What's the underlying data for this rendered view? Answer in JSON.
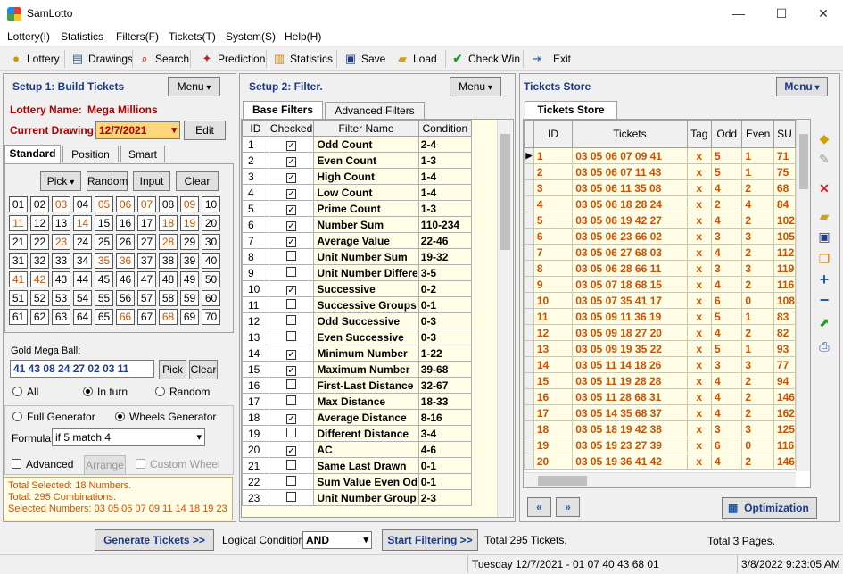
{
  "window": {
    "title": "SamLotto",
    "min": "—",
    "max": "☐",
    "close": "✕"
  },
  "menubar": [
    "Lottery(I)",
    "Statistics",
    "Filters(F)",
    "Tickets(T)",
    "System(S)",
    "Help(H)"
  ],
  "toolbar": {
    "lottery": "Lottery",
    "drawings": "Drawings",
    "search": "Search",
    "prediction": "Prediction",
    "statistics": "Statistics",
    "save": "Save",
    "load": "Load",
    "check_win": "Check Win",
    "exit": "Exit"
  },
  "setup1": {
    "title": "Setup 1: Build  Tickets",
    "menu_button": "Menu",
    "lottery_name_label": "Lottery  Name:",
    "lottery_name": "Mega Millions",
    "current_drawing_label": "Current Drawing:",
    "current_drawing": "12/7/2021",
    "edit": "Edit",
    "tabs": [
      "Standard",
      "Position",
      "Smart"
    ],
    "pick": "Pick",
    "random": "Random",
    "input": "Input",
    "clear": "Clear",
    "numbers": [
      "01",
      "02",
      "03",
      "04",
      "05",
      "06",
      "07",
      "08",
      "09",
      "10",
      "11",
      "12",
      "13",
      "14",
      "15",
      "16",
      "17",
      "18",
      "19",
      "20",
      "21",
      "22",
      "23",
      "24",
      "25",
      "26",
      "27",
      "28",
      "29",
      "30",
      "31",
      "32",
      "33",
      "34",
      "35",
      "36",
      "37",
      "38",
      "39",
      "40",
      "41",
      "42",
      "43",
      "44",
      "45",
      "46",
      "47",
      "48",
      "49",
      "50",
      "51",
      "52",
      "53",
      "54",
      "55",
      "56",
      "57",
      "58",
      "59",
      "60",
      "61",
      "62",
      "63",
      "64",
      "65",
      "66",
      "67",
      "68",
      "69",
      "70"
    ],
    "selected_numbers": [
      "03",
      "05",
      "06",
      "07",
      "09",
      "11",
      "14",
      "18",
      "19",
      "23",
      "28",
      "35",
      "36",
      "41",
      "42",
      "66",
      "68"
    ],
    "gold_ball_label": "Gold Mega Ball:",
    "gold_ball_value": "41 43 08 24 27 02 03 11",
    "gold_pick": "Pick",
    "gold_clear": "Clear",
    "radio_all": "All",
    "radio_in_turn": "In turn",
    "radio_random": "Random",
    "full_generator": "Full Generator",
    "wheels_generator": "Wheels Generator",
    "formula_label": "Formula:",
    "formula_value": "if 5 match 4",
    "advanced": "Advanced",
    "arrange": "Arrange",
    "custom_wheel": "Custom Wheel",
    "status_lines": [
      "Total Selected: 18 Numbers.",
      "Total: 295 Combinations.",
      "Selected Numbers: 03 05 06 07 09 11 14 18 19 23"
    ]
  },
  "setup2": {
    "title": "Setup 2: Filter.",
    "menu_button": "Menu",
    "tabs": [
      "Base Filters",
      "Advanced Filters"
    ],
    "columns": [
      "ID",
      "Checked",
      "Filter Name",
      "Condition"
    ],
    "rows": [
      {
        "id": "1",
        "checked": true,
        "name": "Odd Count",
        "cond": "2-4"
      },
      {
        "id": "2",
        "checked": true,
        "name": "Even Count",
        "cond": "1-3"
      },
      {
        "id": "3",
        "checked": true,
        "name": "High Count",
        "cond": "1-4"
      },
      {
        "id": "4",
        "checked": true,
        "name": "Low Count",
        "cond": "1-4"
      },
      {
        "id": "5",
        "checked": true,
        "name": "Prime Count",
        "cond": "1-3"
      },
      {
        "id": "6",
        "checked": true,
        "name": "Number Sum",
        "cond": "110-234"
      },
      {
        "id": "7",
        "checked": true,
        "name": "Average Value",
        "cond": "22-46"
      },
      {
        "id": "8",
        "checked": false,
        "name": "Unit Number Sum",
        "cond": "19-32"
      },
      {
        "id": "9",
        "checked": false,
        "name": "Unit Number Differe",
        "cond": "3-5"
      },
      {
        "id": "10",
        "checked": true,
        "name": "Successive",
        "cond": "0-2"
      },
      {
        "id": "11",
        "checked": false,
        "name": "Successive Groups",
        "cond": "0-1"
      },
      {
        "id": "12",
        "checked": false,
        "name": "Odd Successive",
        "cond": "0-3"
      },
      {
        "id": "13",
        "checked": false,
        "name": "Even Successive",
        "cond": "0-3"
      },
      {
        "id": "14",
        "checked": true,
        "name": "Minimum Number",
        "cond": "1-22"
      },
      {
        "id": "15",
        "checked": true,
        "name": "Maximum Number",
        "cond": "39-68"
      },
      {
        "id": "16",
        "checked": false,
        "name": "First-Last Distance",
        "cond": "32-67"
      },
      {
        "id": "17",
        "checked": false,
        "name": "Max Distance",
        "cond": "18-33"
      },
      {
        "id": "18",
        "checked": true,
        "name": "Average Distance",
        "cond": "8-16"
      },
      {
        "id": "19",
        "checked": false,
        "name": "Different Distance",
        "cond": "3-4"
      },
      {
        "id": "20",
        "checked": true,
        "name": "AC",
        "cond": "4-6"
      },
      {
        "id": "21",
        "checked": false,
        "name": "Same Last Drawn",
        "cond": "0-1"
      },
      {
        "id": "22",
        "checked": false,
        "name": "Sum Value Even Od",
        "cond": "0-1"
      },
      {
        "id": "23",
        "checked": false,
        "name": "Unit Number Group",
        "cond": "2-3"
      }
    ]
  },
  "store": {
    "title": "Tickets Store",
    "menu_button": "Menu",
    "tab": "Tickets Store",
    "columns": [
      "ID",
      "Tickets",
      "Tag",
      "Odd",
      "Even",
      "SU"
    ],
    "rows": [
      {
        "id": "1",
        "t": "03 05 06 07 09 41",
        "tag": "x",
        "odd": "5",
        "even": "1",
        "su": "71"
      },
      {
        "id": "2",
        "t": "03 05 06 07 11 43",
        "tag": "x",
        "odd": "5",
        "even": "1",
        "su": "75"
      },
      {
        "id": "3",
        "t": "03 05 06 11 35 08",
        "tag": "x",
        "odd": "4",
        "even": "2",
        "su": "68"
      },
      {
        "id": "4",
        "t": "03 05 06 18 28 24",
        "tag": "x",
        "odd": "2",
        "even": "4",
        "su": "84"
      },
      {
        "id": "5",
        "t": "03 05 06 19 42 27",
        "tag": "x",
        "odd": "4",
        "even": "2",
        "su": "102"
      },
      {
        "id": "6",
        "t": "03 05 06 23 66 02",
        "tag": "x",
        "odd": "3",
        "even": "3",
        "su": "105"
      },
      {
        "id": "7",
        "t": "03 05 06 27 68 03",
        "tag": "x",
        "odd": "4",
        "even": "2",
        "su": "112"
      },
      {
        "id": "8",
        "t": "03 05 06 28 66 11",
        "tag": "x",
        "odd": "3",
        "even": "3",
        "su": "119"
      },
      {
        "id": "9",
        "t": "03 05 07 18 68 15",
        "tag": "x",
        "odd": "4",
        "even": "2",
        "su": "116"
      },
      {
        "id": "10",
        "t": "03 05 07 35 41 17",
        "tag": "x",
        "odd": "6",
        "even": "0",
        "su": "108"
      },
      {
        "id": "11",
        "t": "03 05 09 11 36 19",
        "tag": "x",
        "odd": "5",
        "even": "1",
        "su": "83"
      },
      {
        "id": "12",
        "t": "03 05 09 18 27 20",
        "tag": "x",
        "odd": "4",
        "even": "2",
        "su": "82"
      },
      {
        "id": "13",
        "t": "03 05 09 19 35 22",
        "tag": "x",
        "odd": "5",
        "even": "1",
        "su": "93"
      },
      {
        "id": "14",
        "t": "03 05 11 14 18 26",
        "tag": "x",
        "odd": "3",
        "even": "3",
        "su": "77"
      },
      {
        "id": "15",
        "t": "03 05 11 19 28 28",
        "tag": "x",
        "odd": "4",
        "even": "2",
        "su": "94"
      },
      {
        "id": "16",
        "t": "03 05 11 28 68 31",
        "tag": "x",
        "odd": "4",
        "even": "2",
        "su": "146"
      },
      {
        "id": "17",
        "t": "03 05 14 35 68 37",
        "tag": "x",
        "odd": "4",
        "even": "2",
        "su": "162"
      },
      {
        "id": "18",
        "t": "03 05 18 19 42 38",
        "tag": "x",
        "odd": "3",
        "even": "3",
        "su": "125"
      },
      {
        "id": "19",
        "t": "03 05 19 23 27 39",
        "tag": "x",
        "odd": "6",
        "even": "0",
        "su": "116"
      },
      {
        "id": "20",
        "t": "03 05 19 36 41 42",
        "tag": "x",
        "odd": "4",
        "even": "2",
        "su": "146"
      }
    ],
    "optimization": "Optimization"
  },
  "bottom": {
    "generate": "Generate Tickets >>",
    "logical_label": "Logical Condition:",
    "logical_value": "AND",
    "start_filtering": "Start Filtering >>",
    "total_tickets": "Total 295 Tickets.",
    "total_pages": "Total 3 Pages."
  },
  "statusbar": {
    "drawing": "Tuesday 12/7/2021 - 01 07 40 43 68 01",
    "datetime": "3/8/2022 9:23:05 AM"
  },
  "colors": {
    "heading": "#1a3a8a",
    "highlight": "#d05000",
    "grid_bg": "#fffde6",
    "lottery_red": "#b00000"
  }
}
